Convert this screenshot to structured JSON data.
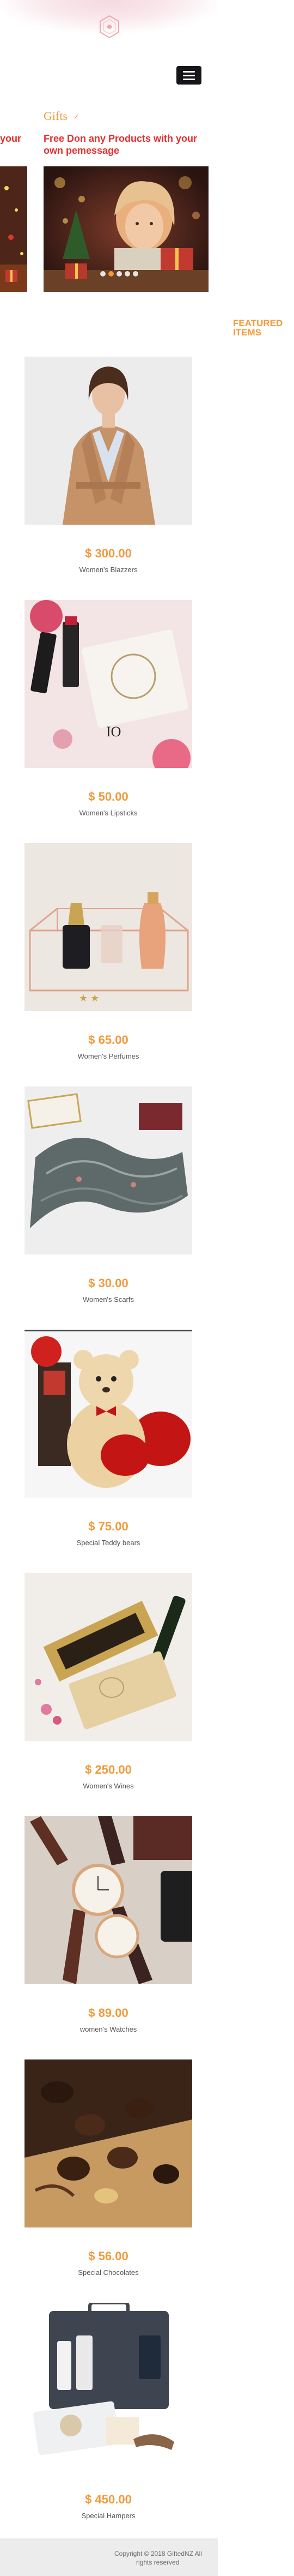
{
  "header": {
    "brand": "GiftedNZ",
    "menu_icon": "hamburger-menu-icon",
    "accent_color": "#f29a3b",
    "headline_color": "#e62e2e"
  },
  "hero": {
    "title": "Gifts",
    "title_accent": "✓",
    "subtitle_line1": "Free Don any Products with your",
    "subtitle_line2": "own pemessage",
    "left_fragment": "your",
    "slides_count": 5,
    "active_slide": 1
  },
  "featured": {
    "heading_line1": "FEATURED",
    "heading_line2": "ITEMS"
  },
  "products": [
    {
      "price": "$ 300.00",
      "name": "Women's Blazzers",
      "image": "blazer-photo"
    },
    {
      "price": "$ 50.00",
      "name": "Women's Lipsticks",
      "image": "lipstick-photo"
    },
    {
      "price": "$ 65.00",
      "name": "Women's Perfumes",
      "image": "perfume-photo"
    },
    {
      "price": "$ 30.00",
      "name": "Women's Scarfs",
      "image": "scarf-photo"
    },
    {
      "price": "$ 75.00",
      "name": "Special Teddy bears",
      "image": "teddy-bear-photo"
    },
    {
      "price": "$ 250.00",
      "name": "Women's Wines",
      "image": "wine-photo"
    },
    {
      "price": "$ 89.00",
      "name": "women's Watches",
      "image": "watch-photo"
    },
    {
      "price": "$ 56.00",
      "name": "Special Chocolates",
      "image": "chocolate-photo"
    },
    {
      "price": "$ 450.00",
      "name": "Special Hampers",
      "image": "hamper-photo"
    }
  ],
  "footer": {
    "copyright_line1": "Copyright © 2018 GiftedNZ All",
    "copyright_line2": "rights reserved"
  }
}
